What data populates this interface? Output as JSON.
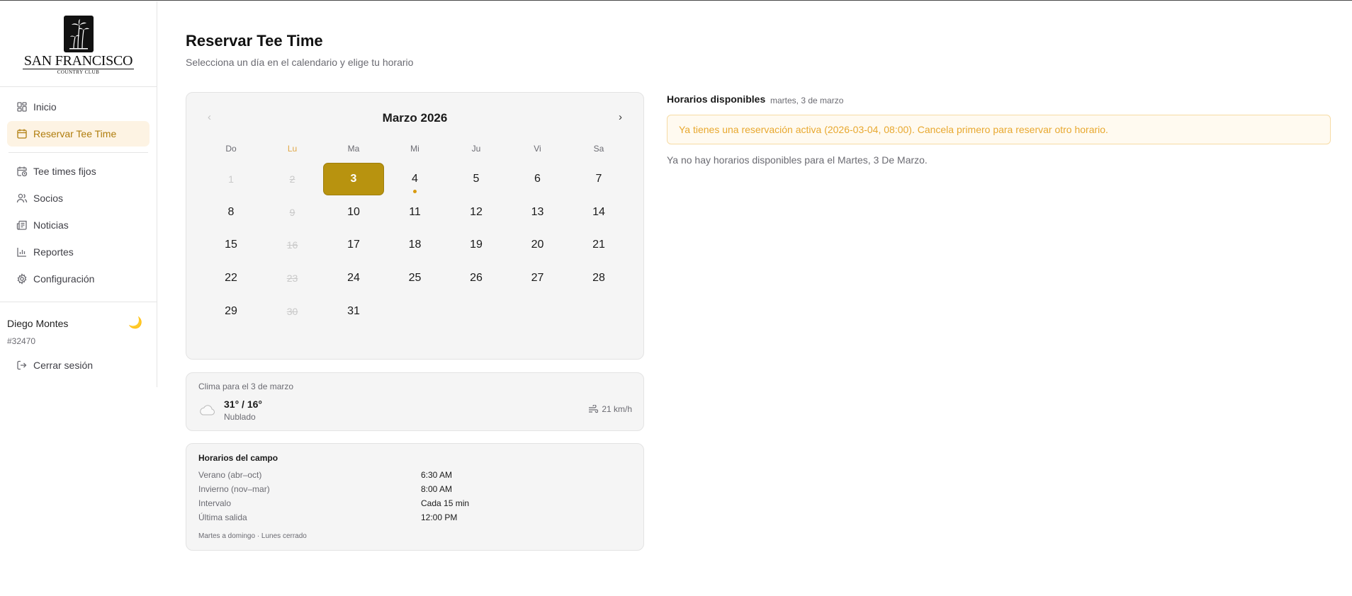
{
  "sidebar": {
    "logo": {
      "word": "SAN FRANCISCO",
      "sub": "COUNTRY CLUB"
    },
    "items": [
      {
        "label": "Inicio",
        "icon": "dashboard-icon"
      },
      {
        "label": "Reservar Tee Time",
        "icon": "calendar-icon",
        "active": true
      },
      {
        "label": "Tee times fijos",
        "icon": "calendar-clock-icon"
      },
      {
        "label": "Socios",
        "icon": "users-icon"
      },
      {
        "label": "Noticias",
        "icon": "newspaper-icon"
      },
      {
        "label": "Reportes",
        "icon": "bar-chart-icon"
      },
      {
        "label": "Configuración",
        "icon": "gear-icon"
      }
    ],
    "user": {
      "name": "Diego Montes",
      "id": "#32470",
      "theme_icon": "🌙",
      "logout": "Cerrar sesión"
    }
  },
  "page": {
    "title": "Reservar Tee Time",
    "subtitle": "Selecciona un día en el calendario y elige tu horario"
  },
  "calendar": {
    "month": "Marzo 2026",
    "prev": "‹",
    "next": "›",
    "weekdays": [
      "Do",
      "Lu",
      "Ma",
      "Mi",
      "Ju",
      "Vi",
      "Sa"
    ],
    "highlight_weekday": "Lu",
    "selected": "3",
    "weeks": [
      [
        {
          "d": "1",
          "s": "dis"
        },
        {
          "d": "2",
          "s": "closed"
        },
        {
          "d": "3",
          "s": "sel"
        },
        {
          "d": "4",
          "s": "dot"
        },
        {
          "d": "5"
        },
        {
          "d": "6"
        },
        {
          "d": "7"
        }
      ],
      [
        {
          "d": "8"
        },
        {
          "d": "9",
          "s": "closed"
        },
        {
          "d": "10"
        },
        {
          "d": "11"
        },
        {
          "d": "12"
        },
        {
          "d": "13"
        },
        {
          "d": "14"
        }
      ],
      [
        {
          "d": "15"
        },
        {
          "d": "16",
          "s": "closed"
        },
        {
          "d": "17"
        },
        {
          "d": "18"
        },
        {
          "d": "19"
        },
        {
          "d": "20"
        },
        {
          "d": "21"
        }
      ],
      [
        {
          "d": "22"
        },
        {
          "d": "23",
          "s": "closed"
        },
        {
          "d": "24"
        },
        {
          "d": "25"
        },
        {
          "d": "26"
        },
        {
          "d": "27"
        },
        {
          "d": "28"
        }
      ],
      [
        {
          "d": "29"
        },
        {
          "d": "30",
          "s": "closed"
        },
        {
          "d": "31"
        }
      ]
    ],
    "accent_color": "#b8930f"
  },
  "weather": {
    "label": "Clima para el 3 de marzo",
    "temp": "31° / 16°",
    "condition": "Nublado",
    "wind": "21 km/h",
    "icon": "cloud-icon"
  },
  "hours": {
    "title": "Horarios del campo",
    "rows": [
      {
        "k": "Verano (abr–oct)",
        "v": "6:30 AM"
      },
      {
        "k": "Invierno (nov–mar)",
        "v": "8:00 AM"
      },
      {
        "k": "Intervalo",
        "v": "Cada 15 min"
      },
      {
        "k": "Última salida",
        "v": "12:00 PM"
      }
    ],
    "footer": "Martes a domingo · Lunes cerrado"
  },
  "availability": {
    "title": "Horarios disponibles",
    "date": "martes, 3 de marzo",
    "alert": "Ya tienes una reservación activa (2026-03-04, 08:00). Cancela primero para reservar otro horario.",
    "empty": "Ya no hay horarios disponibles para el Martes, 3 De Marzo."
  }
}
